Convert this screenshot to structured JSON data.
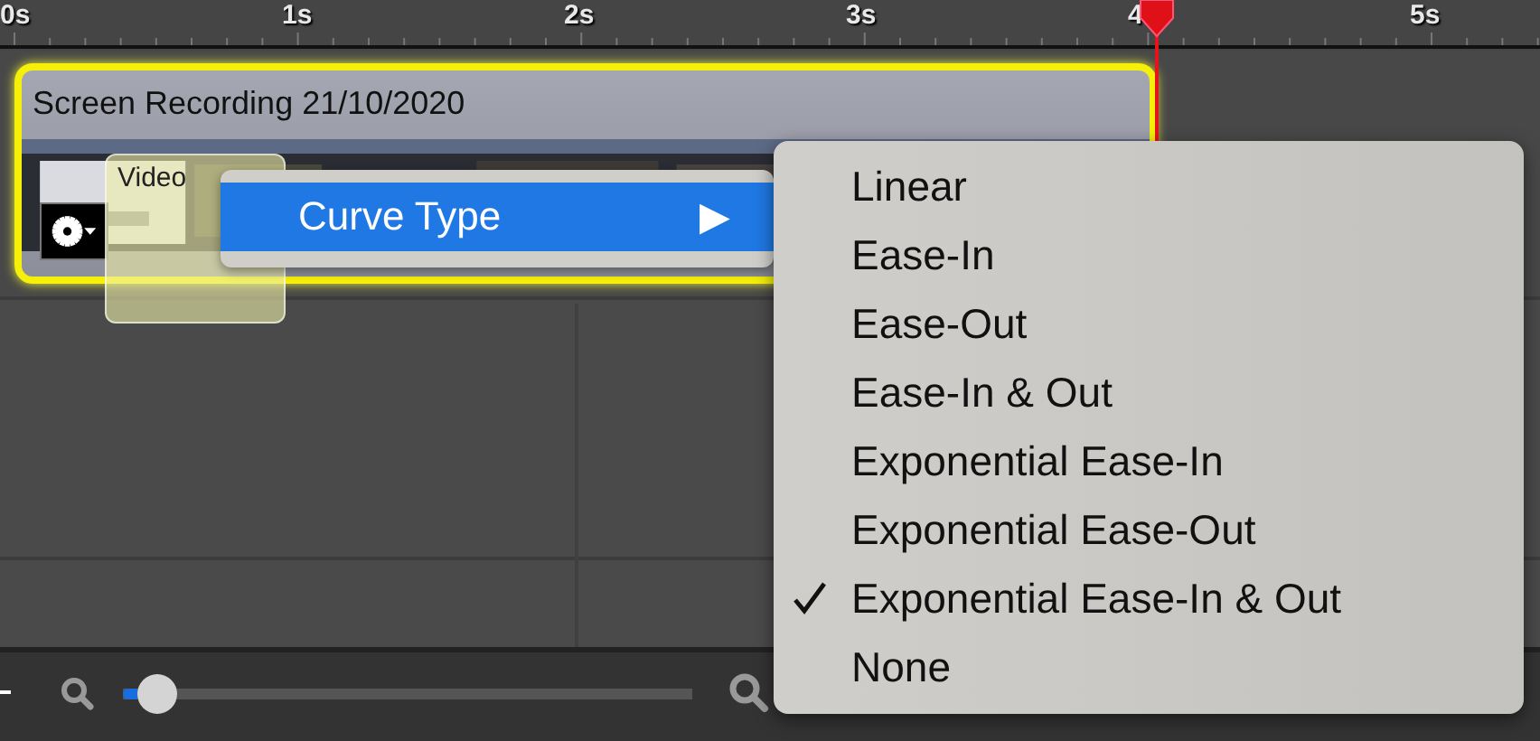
{
  "ruler": {
    "labels": [
      "0s",
      "1s",
      "2s",
      "3s",
      "4",
      "5s"
    ]
  },
  "clip": {
    "title": "Screen Recording 21/10/2020",
    "selected": true
  },
  "track_label": "Video",
  "context_menu": {
    "items": [
      {
        "label": "Curve Type",
        "arrow": "▶",
        "selected": true
      }
    ]
  },
  "submenu": {
    "items": [
      {
        "label": "Linear",
        "checked": false
      },
      {
        "label": "Ease-In",
        "checked": false
      },
      {
        "label": "Ease-Out",
        "checked": false
      },
      {
        "label": "Ease-In & Out",
        "checked": false
      },
      {
        "label": "Exponential Ease-In",
        "checked": false
      },
      {
        "label": "Exponential Ease-Out",
        "checked": false
      },
      {
        "label": "Exponential Ease-In & Out",
        "checked": true
      },
      {
        "label": "None",
        "checked": false
      }
    ]
  },
  "zoom_slider": {
    "level": 0.05
  }
}
